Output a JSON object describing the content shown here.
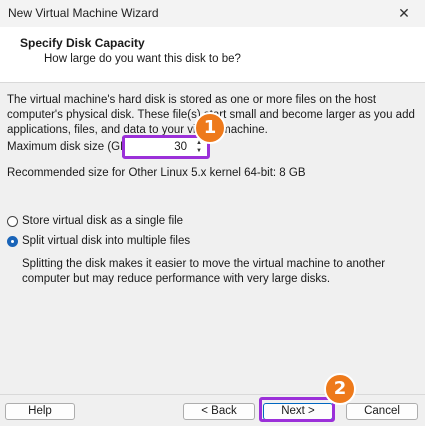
{
  "window": {
    "title": "New Virtual Machine Wizard",
    "close_glyph": "✕"
  },
  "header": {
    "title": "Specify Disk Capacity",
    "subtitle": "How large do you want this disk to be?"
  },
  "body": {
    "description": "The virtual machine's hard disk is stored as one or more files on the host computer's physical disk. These file(s) start small and become larger as you add applications, files, and data to your virtual machine.",
    "max_size_label": "Maximum disk size (GB):",
    "max_size_value": "30",
    "recommendation": "Recommended size for Other Linux 5.x kernel 64-bit: 8 GB",
    "options": [
      {
        "label": "Store virtual disk as a single file",
        "selected": false
      },
      {
        "label": "Split virtual disk into multiple files",
        "selected": true
      }
    ],
    "split_note": "Splitting the disk makes it easier to move the virtual machine to another computer but may reduce performance with very large disks."
  },
  "footer": {
    "help_label": "Help",
    "back_label": "< Back",
    "next_label": "Next >",
    "cancel_label": "Cancel"
  },
  "annotations": {
    "step1": "1",
    "step2": "2",
    "highlight_color": "#9b30d9",
    "badge_color": "#ee7a1b"
  }
}
